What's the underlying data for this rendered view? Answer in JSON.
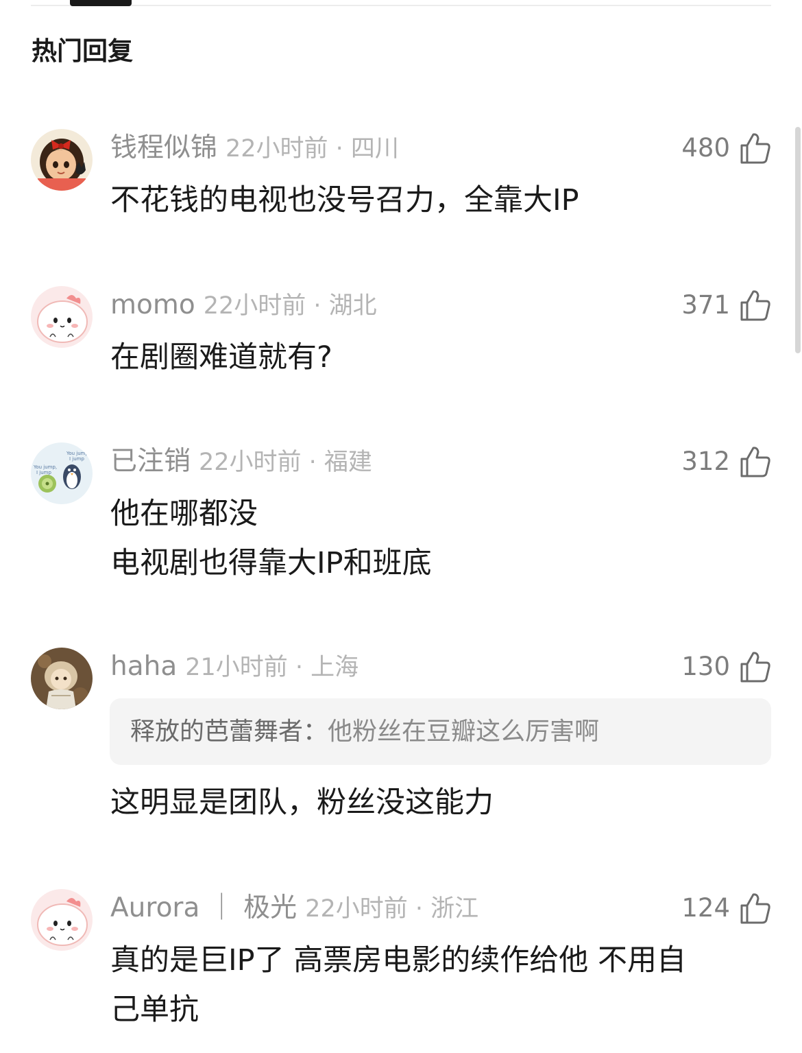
{
  "header": {
    "title": "热门回复"
  },
  "comments": [
    {
      "user": "钱程似锦",
      "time_location": "22小时前 · 四川",
      "likes": "480",
      "text_lines": [
        "不花钱的电视也没号召力，全靠大IP"
      ],
      "avatar": "girl-with-red-bow-avatar"
    },
    {
      "user": "momo",
      "time_location": "22小时前 · 湖北",
      "likes": "371",
      "text_lines": [
        "在剧圈难道就有?"
      ],
      "avatar": "pink-cartoon-avatar"
    },
    {
      "user": "已注销",
      "time_location": "22小时前 · 福建",
      "likes": "312",
      "text_lines": [
        "他在哪都没",
        "电视剧也得靠大IP和班底"
      ],
      "avatar": "kiwi-penguin-avatar",
      "avatar_text": [
        "You jump,",
        "I jump",
        "You jump,",
        "I jump"
      ]
    },
    {
      "user": "haha",
      "time_location": "21小时前 · 上海",
      "likes": "130",
      "quote": {
        "user": "释放的芭蕾舞者：",
        "text": "他粉丝在豆瓣这么厉害啊"
      },
      "text_lines": [
        "这明显是团队，粉丝没这能力"
      ],
      "avatar": "anime-girl-avatar"
    },
    {
      "user": "Aurora ｜ 极光",
      "time_location": "22小时前 · 浙江",
      "likes": "124",
      "text_lines": [
        "真的是巨IP了 高票房电影的续作给他 不用自",
        "己单抗"
      ],
      "avatar": "pink-cartoon-avatar"
    }
  ]
}
